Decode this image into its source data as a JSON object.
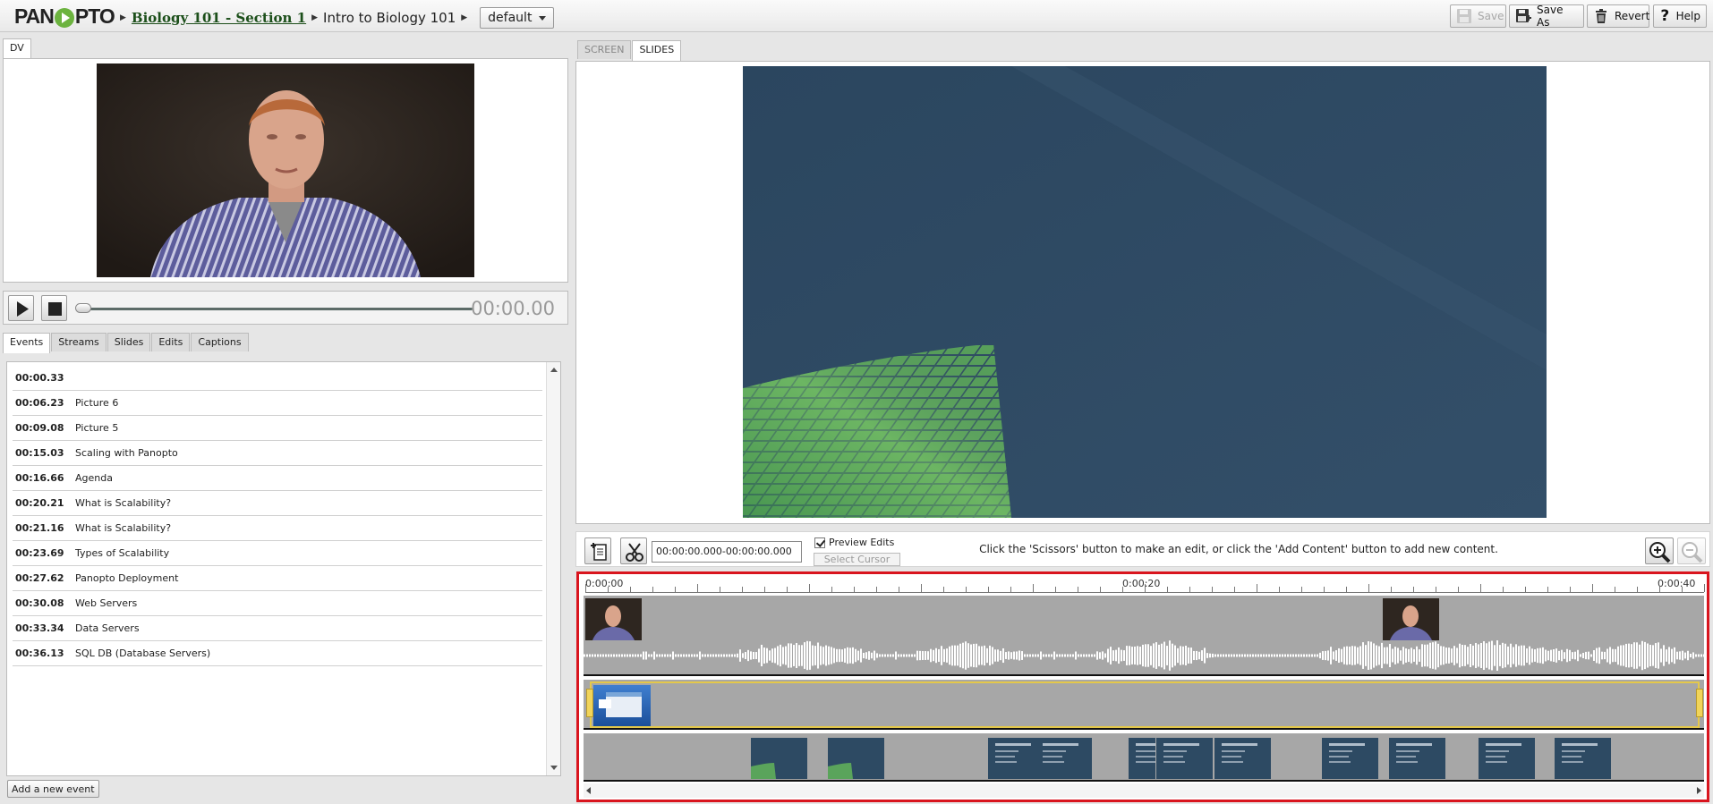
{
  "app": {
    "logo": "PANOPTO",
    "logo_pre": "PAN",
    "logo_post": "PTO"
  },
  "breadcrumb": {
    "course": "Biology 101 - Section 1",
    "session": "Intro to Biology 101",
    "format": "default"
  },
  "toolbar": {
    "save": "Save",
    "save_as": "Save As",
    "revert": "Revert",
    "help": "Help"
  },
  "left_tabs": {
    "dv": "DV"
  },
  "right_tabs": {
    "screen": "SCREEN",
    "slides": "SLIDES"
  },
  "player": {
    "time": "00:00.00"
  },
  "bottom_tabs": [
    "Events",
    "Streams",
    "Slides",
    "Edits",
    "Captions"
  ],
  "events": [
    {
      "time": "00:00.33",
      "name": ""
    },
    {
      "time": "00:06.23",
      "name": "Picture 6"
    },
    {
      "time": "00:09.08",
      "name": "Picture 5"
    },
    {
      "time": "00:15.03",
      "name": "Scaling with Panopto"
    },
    {
      "time": "00:16.66",
      "name": "Agenda"
    },
    {
      "time": "00:20.21",
      "name": "What is Scalability?"
    },
    {
      "time": "00:21.16",
      "name": "What is Scalability?"
    },
    {
      "time": "00:23.69",
      "name": "Types of Scalability"
    },
    {
      "time": "00:27.62",
      "name": "Panopto Deployment"
    },
    {
      "time": "00:30.08",
      "name": "Web Servers"
    },
    {
      "time": "00:33.34",
      "name": "Data Servers"
    },
    {
      "time": "00:36.13",
      "name": "SQL DB (Database Servers)"
    }
  ],
  "add_event": "Add a new event",
  "edit": {
    "range": "00:00:00.000-00:00:00.000",
    "preview_edits": "Preview Edits",
    "preview_checked": true,
    "select_cursor": "Select Cursor",
    "hint": "Click the 'Scissors' button to make an edit, or click the 'Add Content' button to add new content."
  },
  "timeline": {
    "labels": [
      "0:00:00",
      "0:00:20",
      "0:00:40"
    ]
  },
  "colors": {
    "accent_red": "#d9151e",
    "brand_green": "#6cb33f",
    "slide_bg": "#2d4a63",
    "clip_border": "#e4c84a"
  }
}
